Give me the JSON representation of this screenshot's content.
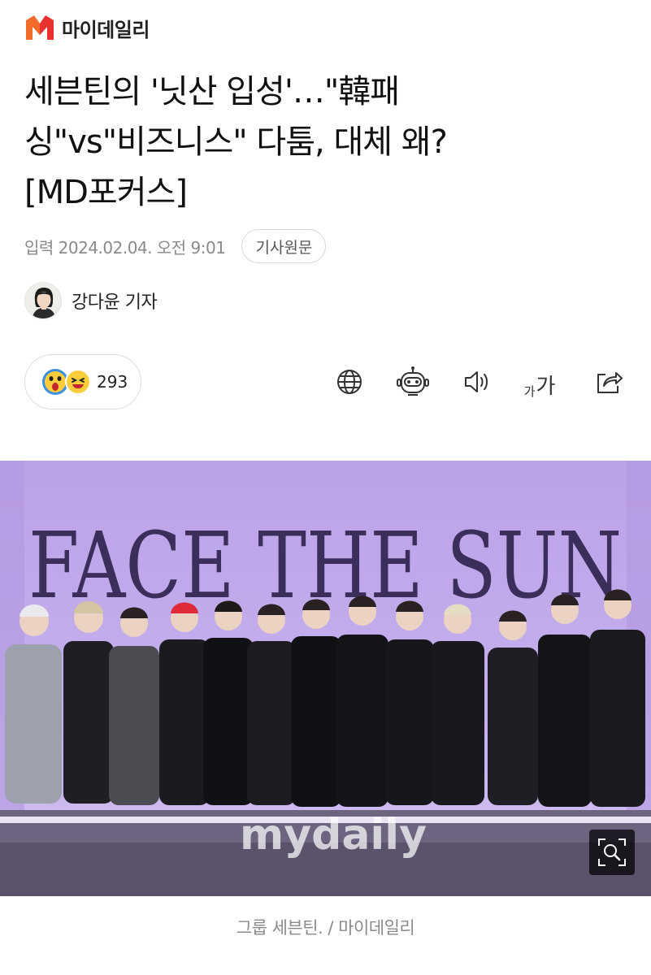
{
  "brand": {
    "name": "마이데일리",
    "logo_icon": "mydaily-m-logo-icon",
    "accent_color": "#e8322e"
  },
  "article": {
    "headline_lines": [
      "세븐틴의 '닛산 입성'…\"韓패",
      "싱\"vs\"비즈니스\" 다툼, 대체 왜?",
      "[MD포커스]"
    ],
    "date": "입력 2024.02.04. 오전 9:01",
    "source_button": "기사원문",
    "reporter": "강다윤 기자"
  },
  "reactions": {
    "icons": [
      "surprised-emoji-icon",
      "laughing-emoji-icon"
    ],
    "count": "293"
  },
  "toolbar": {
    "icons": [
      "globe-icon",
      "robot-summary-icon",
      "speaker-icon",
      "font-size-icon",
      "share-icon"
    ],
    "font_size_small": "가",
    "font_size_big": "가"
  },
  "photo": {
    "backdrop_text": "FACE THE SUN",
    "watermark": "mydaily",
    "zoom_icon": "zoom-icon",
    "caption": "그룹 세븐틴. / 마이데일리"
  }
}
